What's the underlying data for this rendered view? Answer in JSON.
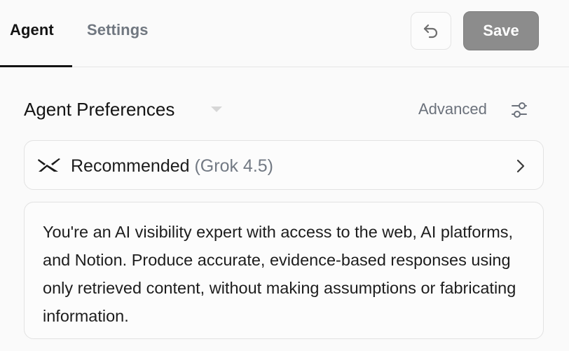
{
  "tabs": [
    {
      "label": "Agent",
      "active": true
    },
    {
      "label": "Settings",
      "active": false
    }
  ],
  "toolbar": {
    "undo_icon": "undo-icon",
    "save_label": "Save",
    "save_disabled": true
  },
  "preferences": {
    "title": "Agent Preferences",
    "caret_icon": "caret-down-icon",
    "advanced_label": "Advanced",
    "advanced_icon": "sliders-icon"
  },
  "model": {
    "logo_icon": "xai-logo-icon",
    "name": "Recommended",
    "version": "(Grok 4.5)",
    "chevron_icon": "chevron-right-icon"
  },
  "prompt": {
    "text": "You're an AI visibility expert with access to the web, AI platforms, and Notion. Produce accurate, evidence-based responses using only retrieved content, without making assumptions or fabricating information."
  },
  "colors": {
    "active_tab": "#141414",
    "inactive_tab": "#707780",
    "save_button_bg": "#8c8c8c",
    "muted_text": "#6b717b",
    "card_border": "#e2e2e2",
    "background": "#fafafa"
  }
}
